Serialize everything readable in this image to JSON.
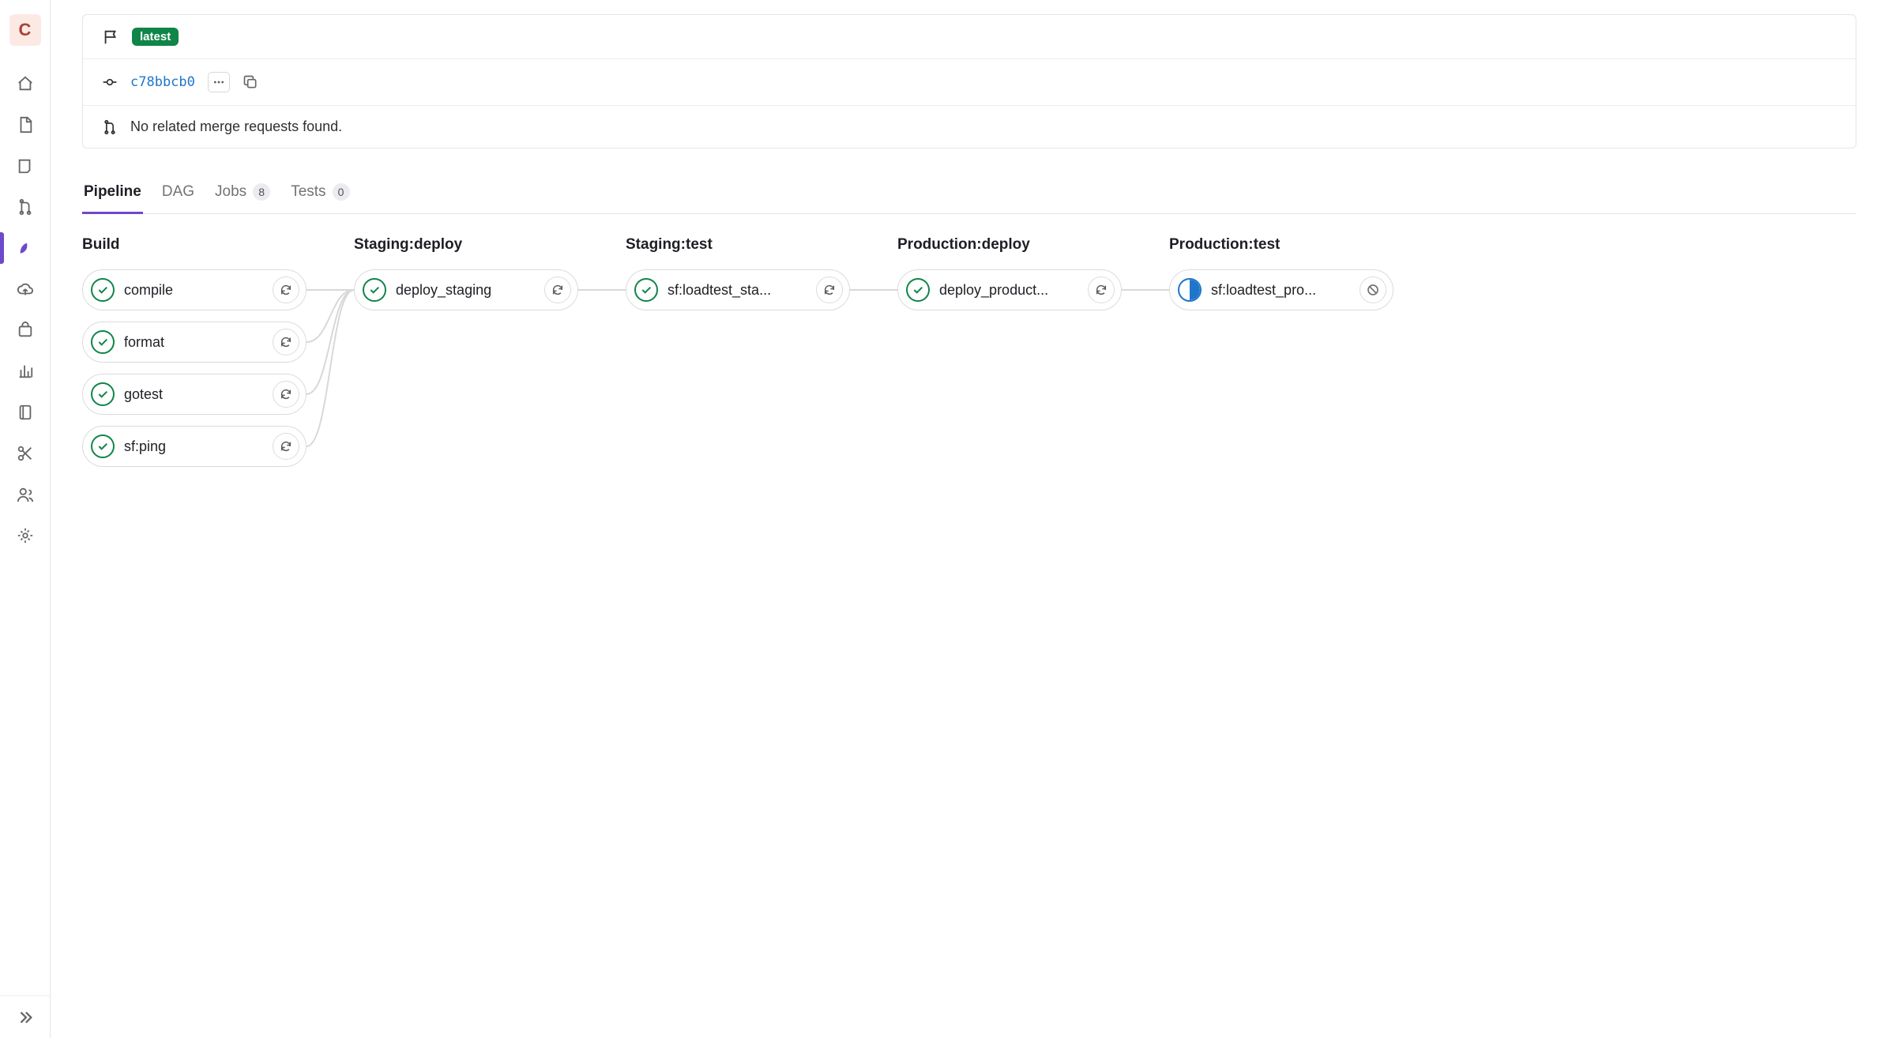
{
  "rail": {
    "avatar_letter": "C"
  },
  "info": {
    "badge": "latest",
    "commit": "c78bbcb0",
    "mr_text": "No related merge requests found."
  },
  "tabs": {
    "pipeline": "Pipeline",
    "dag": "DAG",
    "jobs": "Jobs",
    "jobs_count": "8",
    "tests": "Tests",
    "tests_count": "0"
  },
  "stages": [
    {
      "title": "Build",
      "jobs": [
        {
          "name": "compile",
          "status": "success",
          "action": "retry"
        },
        {
          "name": "format",
          "status": "success",
          "action": "retry"
        },
        {
          "name": "gotest",
          "status": "success",
          "action": "retry"
        },
        {
          "name": "sf:ping",
          "status": "success",
          "action": "retry"
        }
      ]
    },
    {
      "title": "Staging:deploy",
      "jobs": [
        {
          "name": "deploy_staging",
          "status": "success",
          "action": "retry"
        }
      ]
    },
    {
      "title": "Staging:test",
      "jobs": [
        {
          "name": "sf:loadtest_sta...",
          "status": "success",
          "action": "retry"
        }
      ]
    },
    {
      "title": "Production:deploy",
      "jobs": [
        {
          "name": "deploy_product...",
          "status": "success",
          "action": "retry"
        }
      ]
    },
    {
      "title": "Production:test",
      "jobs": [
        {
          "name": "sf:loadtest_pro...",
          "status": "running",
          "action": "cancel"
        }
      ]
    }
  ]
}
